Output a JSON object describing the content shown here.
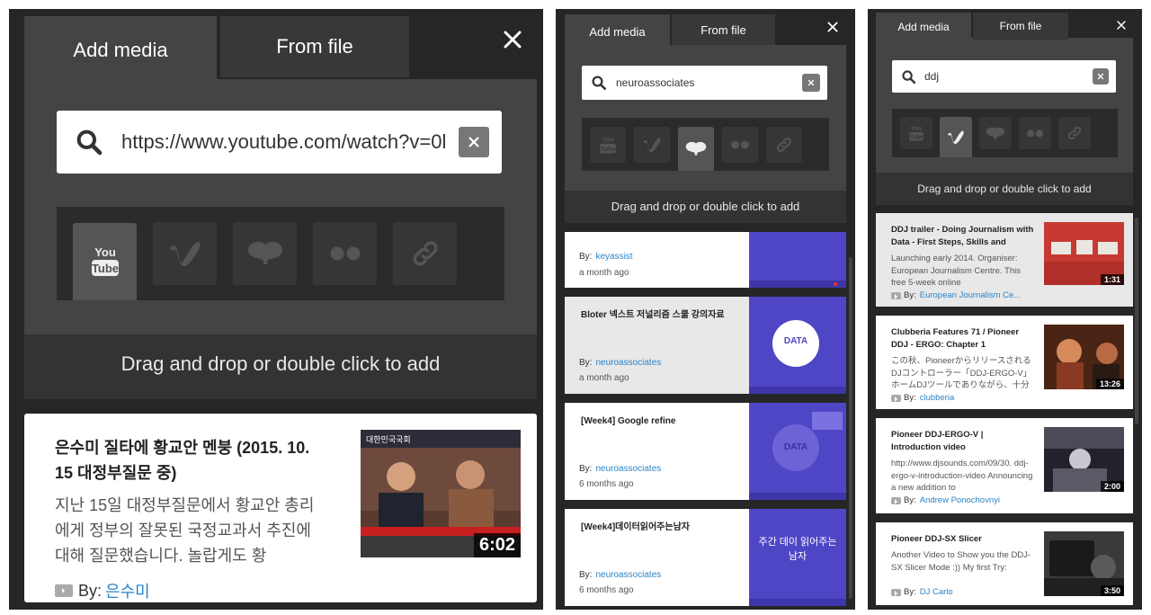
{
  "panel1": {
    "tabs": {
      "add_media": "Add media",
      "from_file": "From file"
    },
    "search": {
      "value": "https://www.youtube.com/watch?v=0l"
    },
    "hint": "Drag and drop or double click to add",
    "item": {
      "title": "은수미 질타에 황교안 멘붕 (2015. 10. 15 대정부질문 중)",
      "desc": "지난 15일 대정부질문에서 황교안 총리에게 정부의 잘못된 국정교과서 추진에 대해 질문했습니다. 놀랍게도 황",
      "by_label": "By:",
      "author": "은수미",
      "duration": "6:02",
      "thumb_caption": "대한민국국회"
    }
  },
  "panel2": {
    "tabs": {
      "add_media": "Add media",
      "from_file": "From file"
    },
    "search": {
      "value": "neuroassociates"
    },
    "hint": "Drag and drop or double click to add",
    "items": [
      {
        "title": "",
        "by_label": "By:",
        "author": "keyassist",
        "ago": "a month ago",
        "thumb_text": ""
      },
      {
        "title": "Bloter 넥스트 저널리즘 스쿨 강의자료",
        "by_label": "By:",
        "author": "neuroassociates",
        "ago": "a month ago",
        "thumb_text": "DATA"
      },
      {
        "title": "[Week4] Google refine",
        "by_label": "By:",
        "author": "neuroassociates",
        "ago": "6 months ago",
        "thumb_text": "DATA"
      },
      {
        "title": "[Week4]데이터읽어주는남자",
        "by_label": "By:",
        "author": "neuroassociates",
        "ago": "6 months ago",
        "thumb_text": "주간 데이 읽어주는 남자"
      }
    ]
  },
  "panel3": {
    "tabs": {
      "add_media": "Add media",
      "from_file": "From file"
    },
    "search": {
      "value": "ddj"
    },
    "hint": "Drag and drop or double click to add",
    "items": [
      {
        "title": "DDJ trailer - Doing Journalism with Data - First Steps, Skills and",
        "desc": "Launching early 2014. Organiser: European Journalism Centre. This free 5-week online",
        "by_label": "By:",
        "author": "European Journalism Ce...",
        "duration": "1:31"
      },
      {
        "title": "Clubberia Features 71 / Pioneer DDJ - ERGO: Chapter 1",
        "desc": "この秋、Pioneerからリリースされる DJコントローラー「DDJ-ERGO-V」 ホームDJツールでありながら、十分",
        "by_label": "By:",
        "author": "clubberia",
        "duration": "13:26"
      },
      {
        "title": "Pioneer DDJ-ERGO-V | Introduction video",
        "desc": "http://www.djsounds.com/09/30. ddj-ergo-v-introduction-video Announcing a new addition to",
        "by_label": "By:",
        "author": "Andrew Ponochovnyi",
        "duration": "2:00"
      },
      {
        "title": "Pioneer DDJ-SX Slicer",
        "desc": "Another Video to Show you the DDJ-SX Slicer Mode :)) My first Try:",
        "by_label": "By:",
        "author": "DJ Carlo",
        "duration": "3:50"
      }
    ]
  },
  "colors": {
    "panel_bg": "#262626",
    "tab_active": "#444444",
    "link": "#2b84c8",
    "slide_purple": "#4f46c6"
  }
}
